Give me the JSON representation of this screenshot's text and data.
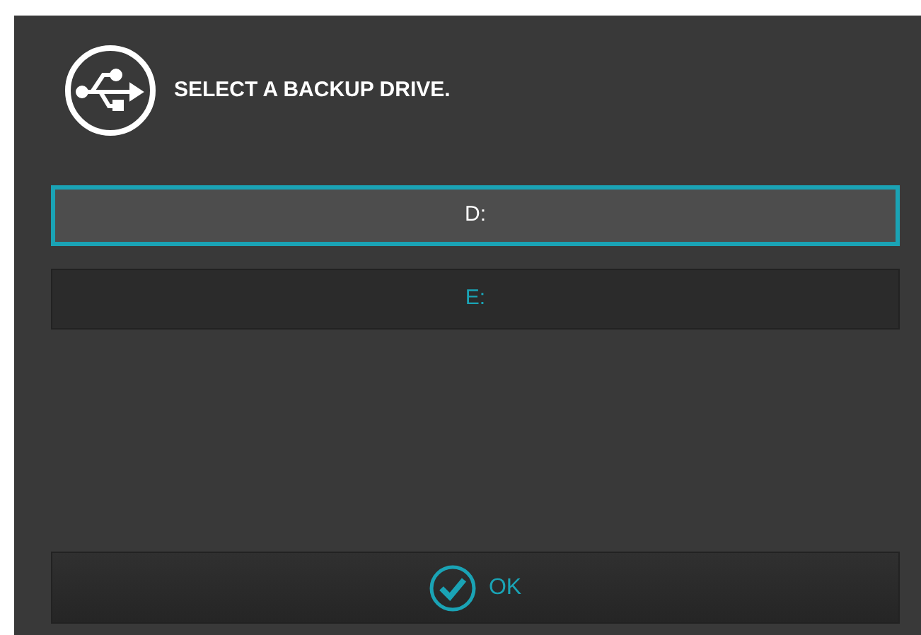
{
  "dialog": {
    "title": "SELECT A BACKUP DRIVE."
  },
  "drives": [
    {
      "label": "D:",
      "selected": true
    },
    {
      "label": "E:",
      "selected": false
    }
  ],
  "buttons": [
    {
      "label": "OK"
    }
  ]
}
